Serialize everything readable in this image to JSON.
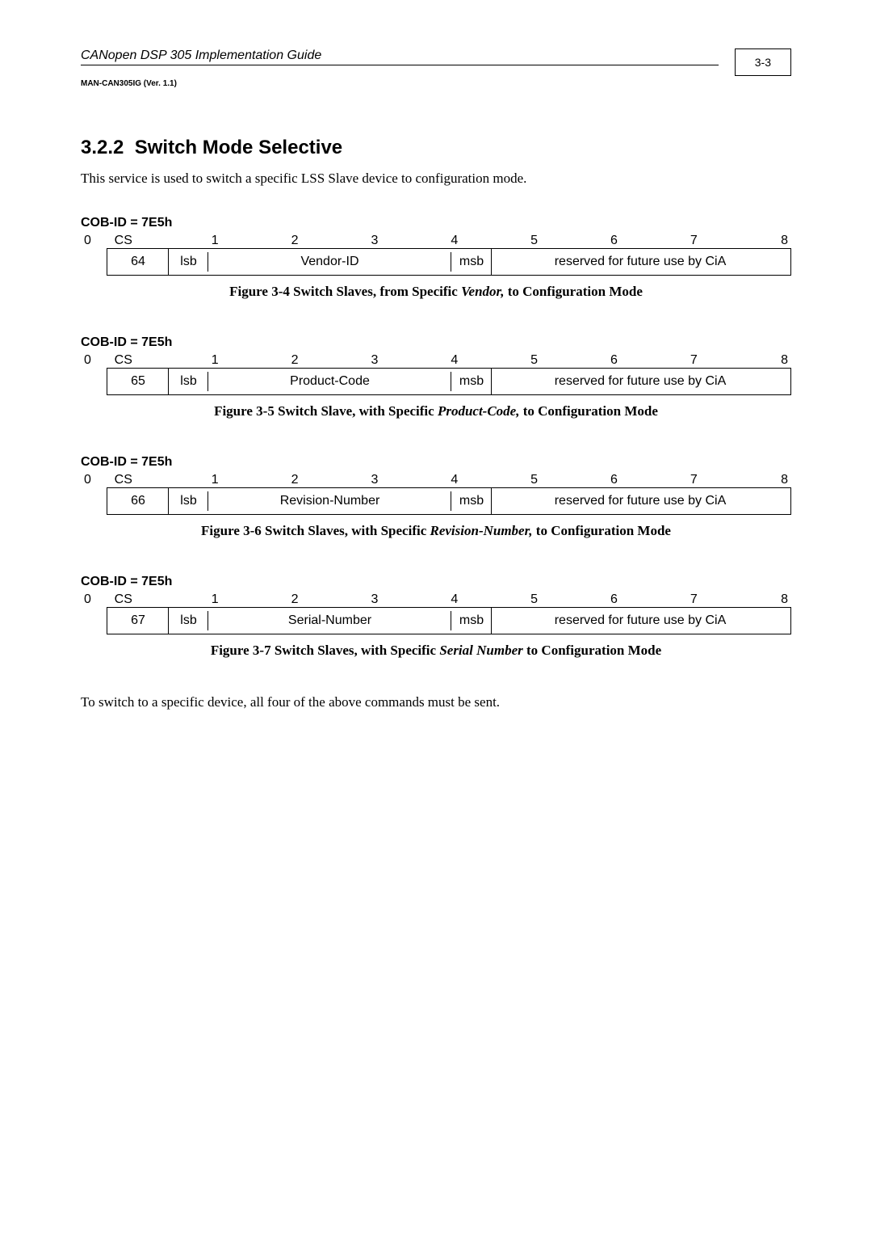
{
  "header": {
    "doc_title": "CANopen DSP 305 Implementation Guide",
    "doc_sub": "MAN-CAN305IG (Ver. 1.1)",
    "page_num": "3-3"
  },
  "section": {
    "number": "3.2.2",
    "title": "Switch Mode Selective",
    "intro": "This service is used to switch a specific LSS Slave device to configuration mode."
  },
  "cobid_label": "COB-ID = 7E5h",
  "nums": {
    "zero": "0",
    "cs": "CS",
    "n1": "1",
    "n2": "2",
    "n3": "3",
    "n4": "4",
    "n5": "5",
    "n6": "6",
    "n7": "7",
    "n8": "8"
  },
  "common": {
    "lsb": "lsb",
    "msb": "msb",
    "reserved": "reserved for future use by CiA"
  },
  "frames": [
    {
      "cs": "64",
      "mid": "Vendor-ID",
      "cap_a": "Figure 3-4  Switch Slaves, from Specific ",
      "cap_i": "Vendor,",
      "cap_b": " to Configuration Mode"
    },
    {
      "cs": "65",
      "mid": "Product-Code",
      "cap_a": "Figure 3-5  Switch Slave, with Specific ",
      "cap_i": "Product-Code,",
      "cap_b": " to Configuration Mode"
    },
    {
      "cs": "66",
      "mid": "Revision-Number",
      "cap_a": "Figure 3-6  Switch Slaves, with Specific ",
      "cap_i": "Revision-Number,",
      "cap_b": " to Configuration Mode"
    },
    {
      "cs": "67",
      "mid": "Serial-Number",
      "cap_a": "Figure 3-7  Switch Slaves, with Specific ",
      "cap_i": "Serial Number ",
      "cap_b": "to Configuration Mode"
    }
  ],
  "closing": "To switch to a specific device, all four of the above commands must be sent."
}
